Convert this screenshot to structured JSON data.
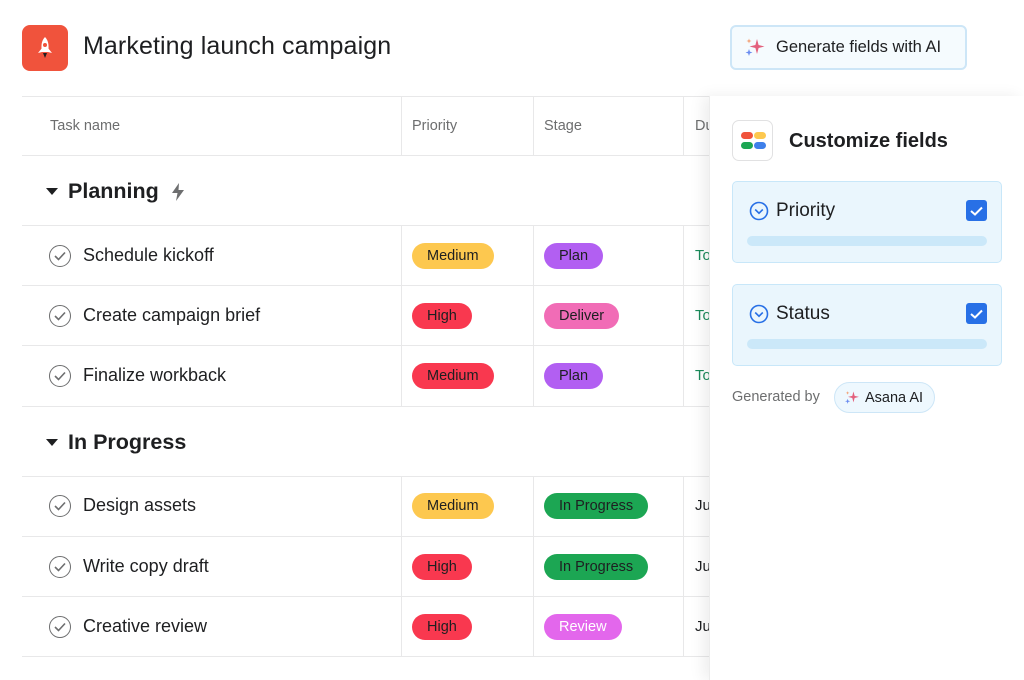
{
  "header": {
    "title": "Marketing launch campaign",
    "ai_button_label": "Generate fields with AI",
    "app_icon": "rocket-icon",
    "brand_color": "#f0533c"
  },
  "table": {
    "columns": [
      "Task name",
      "Priority",
      "Stage",
      "Du"
    ],
    "sections": [
      {
        "title": "Planning",
        "icon": "lightning-icon",
        "rows": [
          {
            "name": "Schedule kickoff",
            "priority": "Medium",
            "stage": "Plan",
            "due": "To"
          },
          {
            "name": "Create campaign brief",
            "priority": "High",
            "stage": "Deliver",
            "due": "To"
          },
          {
            "name": "Finalize workback",
            "priority": "Medium",
            "stage": "Plan",
            "due": "To"
          }
        ]
      },
      {
        "title": "In Progress",
        "rows": [
          {
            "name": "Design assets",
            "priority": "Medium",
            "stage": "In Progress",
            "due": "Ju"
          },
          {
            "name": "Write copy draft",
            "priority": "High",
            "stage": "In Progress",
            "due": "Ju"
          },
          {
            "name": "Creative review",
            "priority": "High",
            "stage": "Review",
            "due": "Ju"
          }
        ]
      }
    ],
    "pill_colors": {
      "Medium": "#fdc84f",
      "High": "#f9384f",
      "Plan": "#b25ff2",
      "Deliver": "#f16cb6",
      "In Progress": "#1ca653",
      "Review": "#e367ec"
    }
  },
  "panel": {
    "title": "Customize fields",
    "fields": [
      {
        "name": "Priority",
        "checked": true
      },
      {
        "name": "Status",
        "checked": true
      }
    ],
    "generated_by_label": "Generated by",
    "ai_chip_label": "Asana AI"
  }
}
